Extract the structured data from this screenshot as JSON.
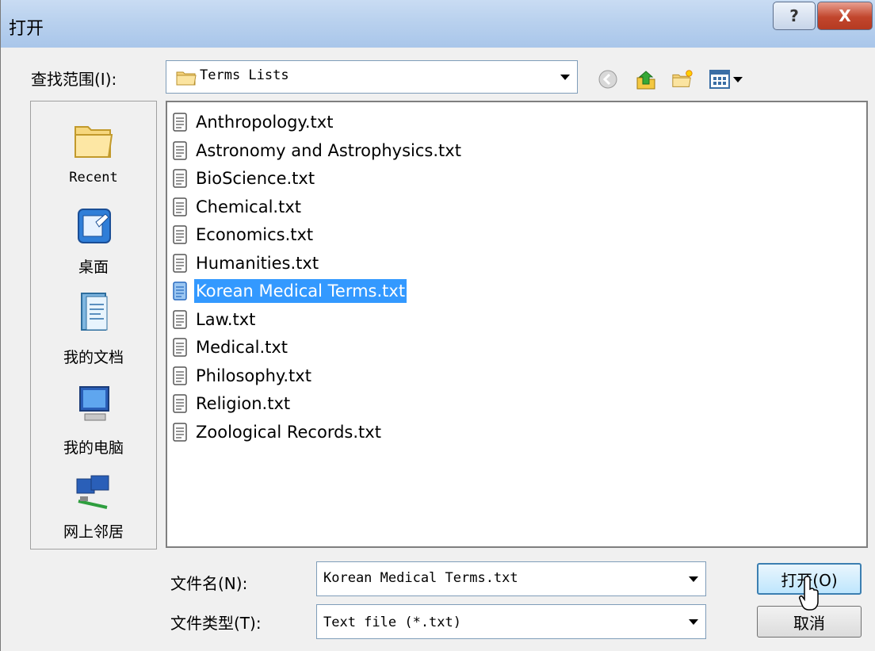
{
  "window": {
    "title": "打开",
    "help_label": "?",
    "close_label": "X"
  },
  "lookin": {
    "label": "查找范围(I):",
    "value": "Terms Lists"
  },
  "places": [
    {
      "label": "Recent",
      "icon": "recent-folder-icon"
    },
    {
      "label": "桌面",
      "icon": "desktop-icon"
    },
    {
      "label": "我的文档",
      "icon": "my-documents-icon"
    },
    {
      "label": "我的电脑",
      "icon": "my-computer-icon"
    },
    {
      "label": "网上邻居",
      "icon": "network-places-icon"
    }
  ],
  "files": [
    {
      "name": "Anthropology.txt"
    },
    {
      "name": "Astronomy and Astrophysics.txt"
    },
    {
      "name": "BioScience.txt"
    },
    {
      "name": "Chemical.txt"
    },
    {
      "name": "Economics.txt"
    },
    {
      "name": "Humanities.txt"
    },
    {
      "name": "Korean Medical Terms.txt",
      "selected": true
    },
    {
      "name": "Law.txt"
    },
    {
      "name": "Medical.txt"
    },
    {
      "name": "Philosophy.txt"
    },
    {
      "name": "Religion.txt"
    },
    {
      "name": "Zoological Records.txt"
    }
  ],
  "filename": {
    "label": "文件名(N):",
    "value": "Korean Medical Terms.txt"
  },
  "filetype": {
    "label": "文件类型(T):",
    "value": "Text file (*.txt)"
  },
  "buttons": {
    "open": "打开(O)",
    "cancel": "取消"
  },
  "colors": {
    "selection": "#3399ff",
    "titlebar": "#b9d1ee"
  }
}
